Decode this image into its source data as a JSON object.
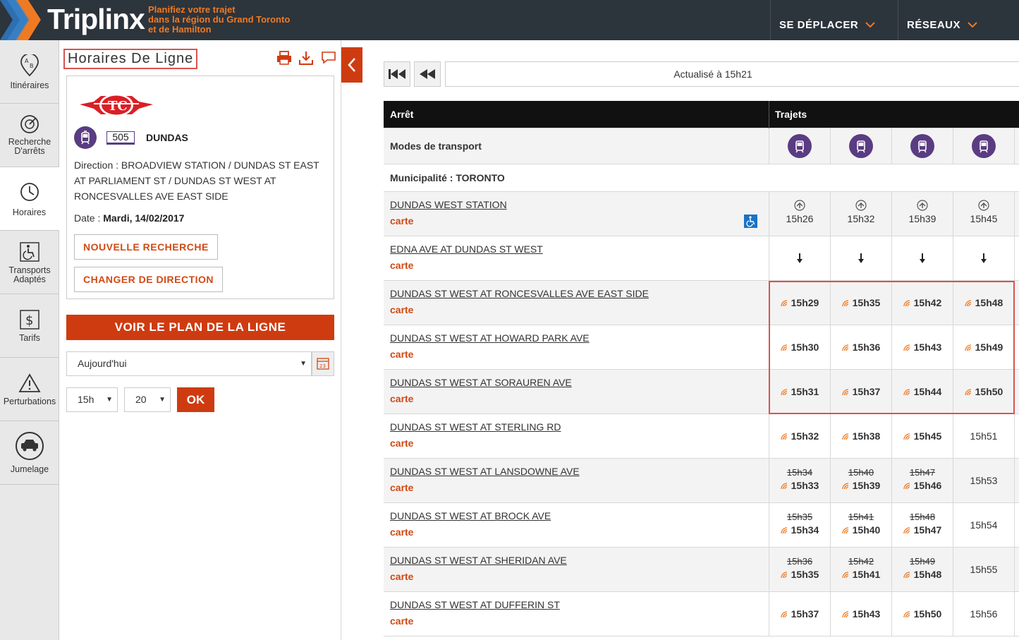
{
  "header": {
    "logo": "Triplinx",
    "tagline": [
      "Planifiez votre trajet",
      "dans la région du Grand Toronto",
      "et de Hamilton"
    ],
    "nav": [
      {
        "label": "SE DÉPLACER"
      },
      {
        "label": "RÉSEAUX"
      }
    ]
  },
  "sidebar": {
    "items": [
      {
        "label": "Itinéraires"
      },
      {
        "label": "Recherche D'arrêts"
      },
      {
        "label": "Horaires"
      },
      {
        "label": "Transports Adaptés"
      },
      {
        "label": "Tarifs"
      },
      {
        "label": "Perturbations"
      },
      {
        "label": "Jumelage"
      }
    ]
  },
  "panel": {
    "title": "Horaires De Ligne",
    "route_number": "505",
    "route_name": "DUNDAS",
    "direction_label": "Direction : ",
    "direction": "BROADVIEW STATION / DUNDAS ST EAST AT PARLIAMENT ST / DUNDAS ST WEST AT RONCESVALLES AVE EAST SIDE",
    "date_label": "Date : ",
    "date": "Mardi, 14/02/2017",
    "new_search": "NOUVELLE RECHERCHE",
    "change_direction": "CHANGER DE DIRECTION",
    "view_plan": "VOIR LE PLAN DE LA LIGNE",
    "day_select": "Aujourd'hui",
    "hour_select": "15h",
    "minute_select": "20",
    "ok": "OK"
  },
  "schedule": {
    "updated": "Actualisé à 15h21",
    "col_stop": "Arrêt",
    "col_trips": "Trajets",
    "modes_label": "Modes de transport",
    "municipality": "Municipalité : TORONTO",
    "map_label": "carte",
    "stops": [
      {
        "name": "DUNDAS WEST STATION",
        "times": [
          {
            "sched": "15h26"
          },
          {
            "sched": "15h32"
          },
          {
            "sched": "15h39"
          },
          {
            "sched": "15h45"
          }
        ],
        "kind": "origin"
      },
      {
        "name": "EDNA AVE AT DUNDAS ST WEST",
        "times": [
          {},
          {},
          {},
          {}
        ],
        "kind": "arrow"
      },
      {
        "name": "DUNDAS ST WEST AT RONCESVALLES AVE EAST SIDE",
        "times": [
          {
            "rt": "15h29"
          },
          {
            "rt": "15h35"
          },
          {
            "rt": "15h42"
          },
          {
            "rt": "15h48"
          }
        ]
      },
      {
        "name": "DUNDAS ST WEST AT HOWARD PARK AVE",
        "times": [
          {
            "rt": "15h30"
          },
          {
            "rt": "15h36"
          },
          {
            "rt": "15h43"
          },
          {
            "rt": "15h49"
          }
        ]
      },
      {
        "name": "DUNDAS ST WEST AT SORAUREN AVE",
        "times": [
          {
            "rt": "15h31"
          },
          {
            "rt": "15h37"
          },
          {
            "rt": "15h44"
          },
          {
            "rt": "15h50"
          }
        ]
      },
      {
        "name": "DUNDAS ST WEST AT STERLING RD",
        "times": [
          {
            "rt": "15h32"
          },
          {
            "rt": "15h38"
          },
          {
            "rt": "15h45"
          },
          {
            "sched": "15h51"
          }
        ]
      },
      {
        "name": "DUNDAS ST WEST AT LANSDOWNE AVE",
        "times": [
          {
            "old": "15h34",
            "rt": "15h33"
          },
          {
            "old": "15h40",
            "rt": "15h39"
          },
          {
            "old": "15h47",
            "rt": "15h46"
          },
          {
            "sched": "15h53"
          }
        ]
      },
      {
        "name": "DUNDAS ST WEST AT BROCK AVE",
        "times": [
          {
            "old": "15h35",
            "rt": "15h34"
          },
          {
            "old": "15h41",
            "rt": "15h40"
          },
          {
            "old": "15h48",
            "rt": "15h47"
          },
          {
            "sched": "15h54"
          }
        ]
      },
      {
        "name": "DUNDAS ST WEST AT SHERIDAN AVE",
        "times": [
          {
            "old": "15h36",
            "rt": "15h35"
          },
          {
            "old": "15h42",
            "rt": "15h41"
          },
          {
            "old": "15h49",
            "rt": "15h48"
          },
          {
            "sched": "15h55"
          }
        ]
      },
      {
        "name": "DUNDAS ST WEST AT DUFFERIN ST",
        "times": [
          {
            "rt": "15h37"
          },
          {
            "rt": "15h43"
          },
          {
            "rt": "15h50"
          },
          {
            "sched": "15h56"
          }
        ]
      }
    ]
  },
  "colors": {
    "header_bg": "#2c343c",
    "accent": "#cf3b10",
    "tagline": "#f07a22",
    "tram": "#5a3c82",
    "highlight": "#d9534f"
  }
}
